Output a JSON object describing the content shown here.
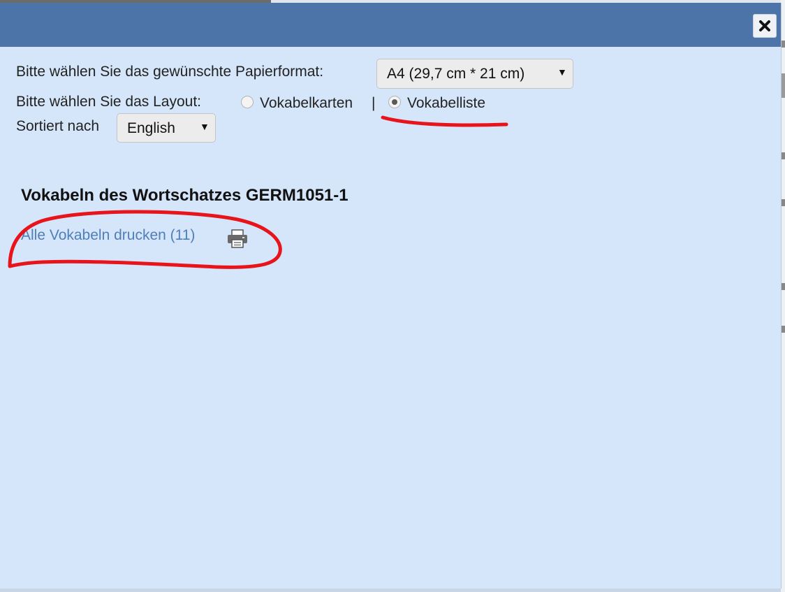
{
  "dialog": {
    "close_icon": "close-icon"
  },
  "form": {
    "paper_label": "Bitte wählen Sie das gewünschte Papierformat:",
    "paper_value": "A4 (29,7 cm * 21 cm)",
    "layout_label": "Bitte wählen Sie das Layout:",
    "layout_option_cards": "Vokabelkarten",
    "layout_separator": "|",
    "layout_option_list": "Vokabelliste",
    "layout_selected": "Vokabelliste",
    "sort_label": "Sortiert nach",
    "sort_value": "English"
  },
  "content": {
    "heading": "Vokabeln des Wortschatzes GERM1051-1",
    "print_all_link": "Alle Vokabeln drucken (11)",
    "print_icon": "printer-icon"
  },
  "colors": {
    "titlebar": "#4c74a8",
    "dialog_bg": "#d6e6fa",
    "link": "#4f7fb8",
    "annotation": "#e8141c"
  }
}
